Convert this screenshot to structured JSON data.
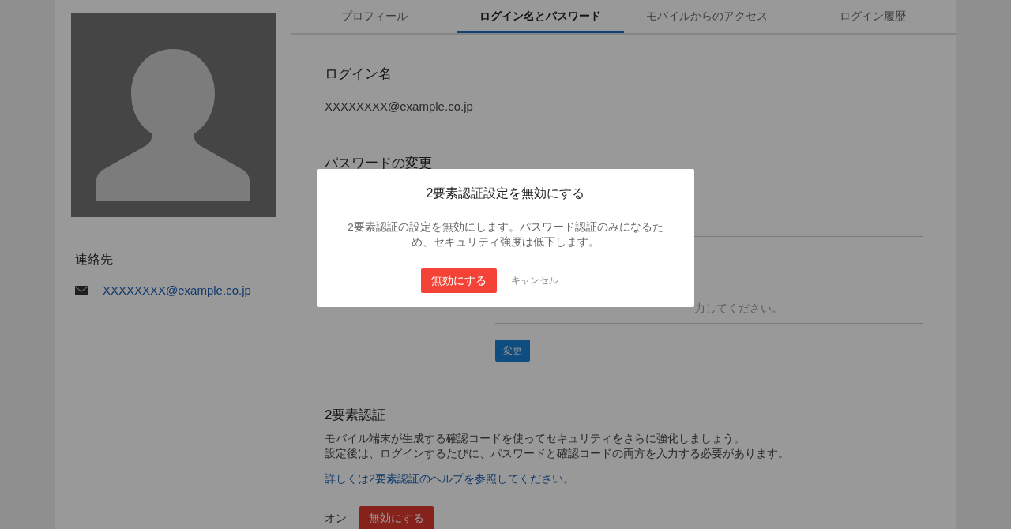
{
  "tabs": [
    {
      "label": "プロフィール",
      "selected": false
    },
    {
      "label": "ログイン名とパスワード",
      "selected": true
    },
    {
      "label": "モバイルからのアクセス",
      "selected": false
    },
    {
      "label": "ログイン履歴",
      "selected": false
    }
  ],
  "sidebar": {
    "contact_heading": "連絡先",
    "email": "XXXXXXXX@example.co.jp"
  },
  "login_name": {
    "heading": "ログイン名",
    "value": "XXXXXXXX@example.co.jp"
  },
  "password_change": {
    "heading": "パスワードの変更",
    "fields": [
      {
        "kind": "blank"
      },
      {
        "kind": "blank"
      },
      {
        "kind": "hint",
        "placeholder": "力してください。"
      }
    ],
    "button": "変更"
  },
  "two_factor": {
    "heading": "2要素認証",
    "description": [
      "モバイル端末が生成する確認コードを使ってセキュリティをさらに強化しましょう。",
      "設定後は、ログインするたびに、パスワードと確認コードの両方を入力する必要があります。"
    ],
    "help_link": "詳しくは2要素認証のヘルプを参照してください。",
    "status": "オン",
    "button": "無効にする"
  },
  "dialog": {
    "title": "2要素認証設定を無効にする",
    "message": "2要素認証の設定を無効にします。パスワード認証のみになるため、セキュリティ強度は低下します。",
    "confirm_button": "無効にする",
    "cancel_button": "キャンセル"
  }
}
